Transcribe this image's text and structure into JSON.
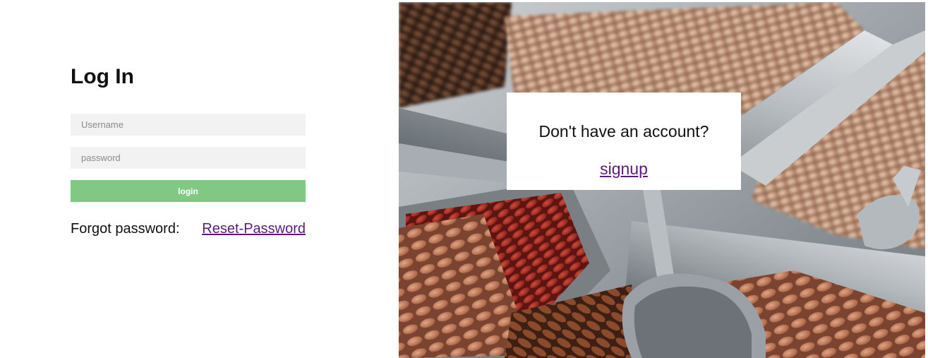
{
  "login": {
    "title": "Log In",
    "username_placeholder": "Username",
    "password_placeholder": "password",
    "login_button_label": "login",
    "forgot_label": "Forgot password:",
    "reset_link_label": "Reset-Password"
  },
  "signup": {
    "question": "Don't have an account?",
    "link_label": "signup"
  },
  "colors": {
    "login_button": "#80c884",
    "link": "#5a1a7a",
    "input_background": "#f2f2f2"
  },
  "images": {
    "background_photo": "photo of metal bins filled with almonds and nuts with a scoop"
  }
}
